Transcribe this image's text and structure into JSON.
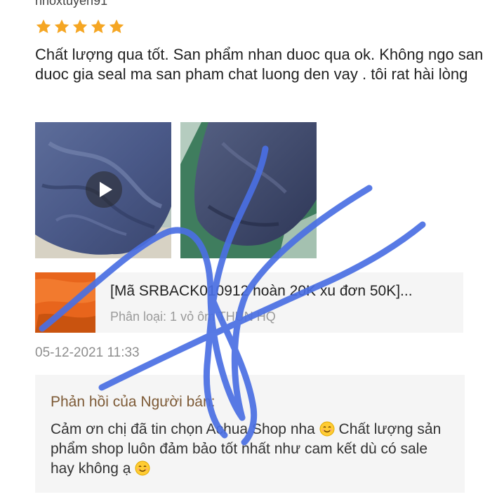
{
  "review": {
    "username": "nnoxtuyen91",
    "rating": 5,
    "text": "Chất lượng qua tốt. San phẩm nhan duoc qua ok. Không ngo san duoc gia seal ma san pham chat luong den vay . tôi rat hài lòng",
    "date": "05-12-2021 11:33"
  },
  "product": {
    "title": "[Mã SRBACK010912 hoàn 20K xu đơn 50K]...",
    "variant": "Phân loại: 1 vỏ ôm THUN HQ"
  },
  "seller_reply": {
    "label": "Phản hồi của Người bán:",
    "text_part1": "Cảm ơn chị đã tin chọn Achua Shop nha ",
    "text_part2": " Chất lượng sản phẩm shop luôn đảm bảo tốt nhất như cam kết dù có sale hay không ạ "
  },
  "colors": {
    "star": "#f5a623",
    "scribble": "#4a6fe3",
    "seller_label": "#7d5a36",
    "card_bg": "#f5f5f5",
    "product_thumb": "#e8651c"
  },
  "icons": {
    "rating": "star-icon",
    "media_badge": "play-icon",
    "reaction": "smiling-face-emoji"
  }
}
